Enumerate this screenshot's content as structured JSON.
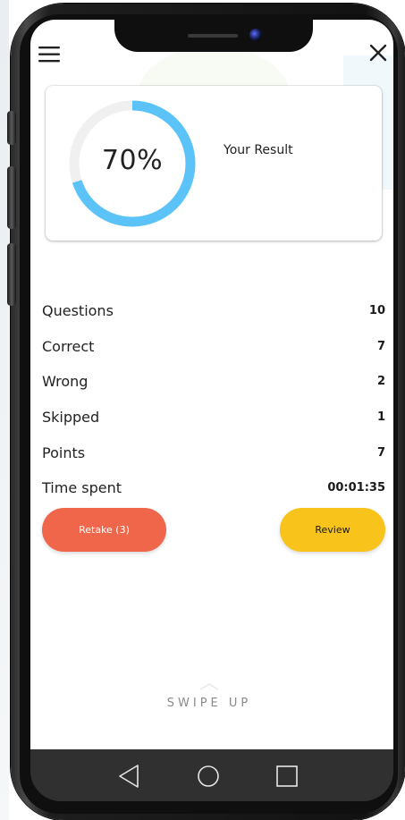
{
  "header": {
    "menu_icon": "hamburger-menu-icon",
    "close_icon": "close-icon"
  },
  "result": {
    "percent_label": "70%",
    "percent_value": 70,
    "title": "Your Result",
    "gauge_color": "#5bc3f7",
    "gauge_track_color": "#f0f0f0"
  },
  "stats": [
    {
      "label": "Questions",
      "value": "10"
    },
    {
      "label": "Correct",
      "value": "7"
    },
    {
      "label": "Wrong",
      "value": "2"
    },
    {
      "label": "Skipped",
      "value": "1"
    },
    {
      "label": "Points",
      "value": "7"
    },
    {
      "label": "Time spent",
      "value": "00:01:35"
    }
  ],
  "actions": {
    "retake_label": "Retake (3)",
    "review_label": "Review",
    "retake_color": "#f0664a",
    "review_color": "#f8c31b"
  },
  "swipe": {
    "label": "SWIPE UP"
  },
  "navbar": {
    "back_icon": "back-triangle-icon",
    "home_icon": "home-circle-icon",
    "recents_icon": "recents-square-icon"
  }
}
